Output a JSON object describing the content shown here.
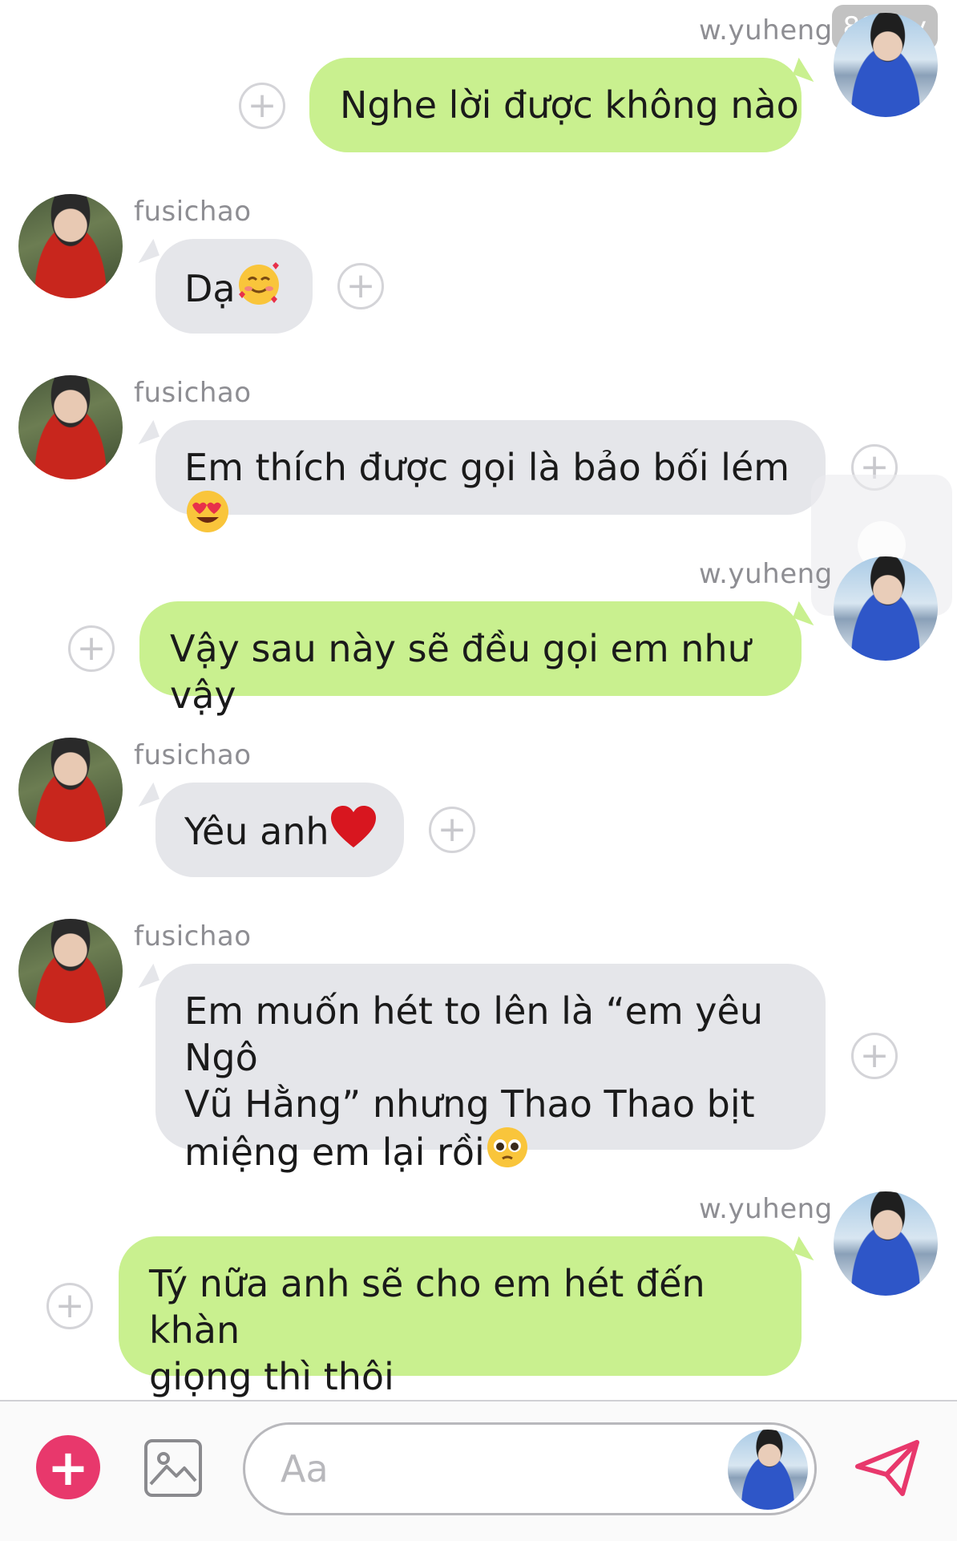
{
  "watermark": "89 joy",
  "messages": [
    {
      "sender": "w.yuheng",
      "side": "right",
      "text": "Nghe lời được không nào",
      "emoji": ""
    },
    {
      "sender": "fusichao",
      "side": "left",
      "text": "Dạ",
      "emoji": "smiling-face-with-hearts"
    },
    {
      "sender": "fusichao",
      "side": "left",
      "text": "Em thích được gọi là bảo bối lém",
      "emoji": "heart-eyes"
    },
    {
      "sender": "w.yuheng",
      "side": "right",
      "text": "Vậy sau này sẽ đều gọi em như vậy",
      "emoji": ""
    },
    {
      "sender": "fusichao",
      "side": "left",
      "text": "Yêu anh",
      "emoji": "red-heart"
    },
    {
      "sender": "fusichao",
      "side": "left",
      "lines": [
        "Em muốn hét to lên là “em yêu Ngô",
        "Vũ Hằng” nhưng Thao Thao bịt",
        "miệng em lại rồi"
      ],
      "emoji": "pleading-face"
    },
    {
      "sender": "w.yuheng",
      "side": "right",
      "lines": [
        "Tý nữa anh sẽ cho em hét đến khàn",
        "giọng thì thôi"
      ],
      "emoji": ""
    }
  ],
  "composer": {
    "placeholder": "Aa",
    "add_icon": "plus-icon",
    "image_icon": "image-icon",
    "send_icon": "send-icon"
  },
  "colors": {
    "incoming_bubble": "#e5e6ea",
    "outgoing_bubble": "#c9f08f",
    "add_button": "#e8386c"
  }
}
